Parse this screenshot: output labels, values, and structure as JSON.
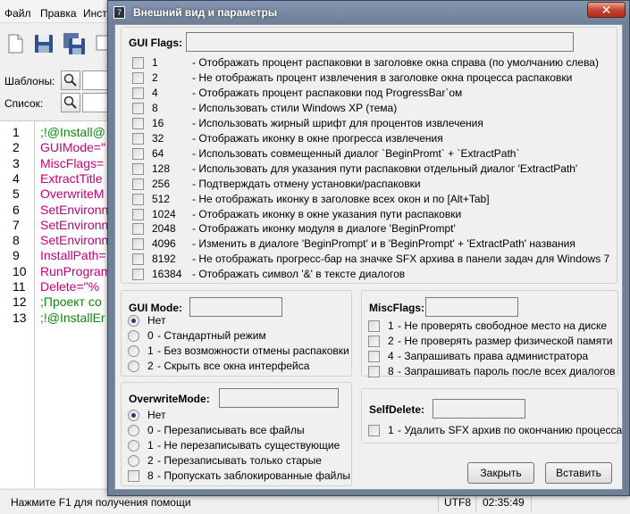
{
  "app": {
    "menu": [
      "Файл",
      "Правка",
      "Инстр"
    ],
    "templates_label": "Шаблоны:",
    "list_label": "Список:",
    "editor_lines": [
      {
        "num": "1",
        "code": ";!@Install@",
        "color": "#0a8a0a"
      },
      {
        "num": "2",
        "code": "GUIMode=\"",
        "color": "#c0007a"
      },
      {
        "num": "3",
        "code": "MiscFlags=",
        "color": "#c0007a"
      },
      {
        "num": "4",
        "code": "ExtractTitle",
        "color": "#c0007a"
      },
      {
        "num": "5",
        "code": "OverwriteM",
        "color": "#c0007a"
      },
      {
        "num": "6",
        "code": "SetEnvironn",
        "color": "#c0007a"
      },
      {
        "num": "7",
        "code": "SetEnvironn",
        "color": "#c0007a"
      },
      {
        "num": "8",
        "code": "SetEnvironn",
        "color": "#c0007a"
      },
      {
        "num": "9",
        "code": "InstallPath=",
        "color": "#c0007a"
      },
      {
        "num": "10",
        "code": "RunProgram",
        "color": "#c0007a"
      },
      {
        "num": "11",
        "code": "Delete=\"%",
        "color": "#c0007a"
      },
      {
        "num": "12",
        "code": ";Проект со",
        "color": "#0a8a0a"
      },
      {
        "num": "13",
        "code": ";!@InstallEr",
        "color": "#0a8a0a"
      }
    ],
    "status": {
      "help": "Нажмите F1 для получения помощи",
      "encoding": "UTF8",
      "time": "02:35:49"
    }
  },
  "dialog": {
    "title": "Внешний вид и параметры",
    "close_glyph": "✕",
    "gui_flags": {
      "label": "GUI Flags:",
      "items": [
        {
          "value": "1",
          "desc": "- Отображать процент распаковки в заголовке окна справа (по умолчанию слева)"
        },
        {
          "value": "2",
          "desc": "- Не отображать процент извлечения в заголовке окна процесса распаковки"
        },
        {
          "value": "4",
          "desc": "- Отображать процент распаковки под ProgressBar`ом"
        },
        {
          "value": "8",
          "desc": "- Использовать стили Windows XP (тема)"
        },
        {
          "value": "16",
          "desc": "- Использовать жирный шрифт для процентов извлечения"
        },
        {
          "value": "32",
          "desc": "- Отображать иконку в окне прогресса извлечения"
        },
        {
          "value": "64",
          "desc": "- Использовать совмещенный диалог `BeginPromt` + `ExtractPath`"
        },
        {
          "value": "128",
          "desc": "- Использовать для указания пути распаковки отдельный диалог 'ExtractPath'"
        },
        {
          "value": "256",
          "desc": "- Подтверждать отмену установки/распаковки"
        },
        {
          "value": "512",
          "desc": "- Не отображать иконку в заголовке всех окон и по [Alt+Tab]"
        },
        {
          "value": "1024",
          "desc": "- Отображать иконку в окне указания пути распаковки"
        },
        {
          "value": "2048",
          "desc": "- Отображать иконку модуля в диалоге 'BeginPrompt'"
        },
        {
          "value": "4096",
          "desc": "- Изменить в диалоге 'BeginPrompt' и в 'BeginPrompt' + 'ExtractPath' названия"
        },
        {
          "value": "8192",
          "desc": "- Не отображать прогресс-бар на значке SFX архива в панели задач для Windows 7"
        },
        {
          "value": "16384",
          "desc": "- Отображать символ '&' в тексте диалогов"
        }
      ]
    },
    "gui_mode": {
      "label": "GUI Mode:",
      "options": [
        {
          "value": "Нет",
          "desc": ""
        },
        {
          "value": "0",
          "desc": "- Стандартный режим"
        },
        {
          "value": "1",
          "desc": "- Без возможности отмены распаковки"
        },
        {
          "value": "2",
          "desc": "- Скрыть все окна интерфейса"
        }
      ]
    },
    "misc_flags": {
      "label": "MiscFlags:",
      "items": [
        {
          "value": "1",
          "desc": "- Не проверять свободное место на диске"
        },
        {
          "value": "2",
          "desc": "- Не проверять размер физической памяти"
        },
        {
          "value": "4",
          "desc": "- Запрашивать права администратора"
        },
        {
          "value": "8",
          "desc": "- Запрашивать пароль после всех диалогов"
        }
      ]
    },
    "overwrite_mode": {
      "label": "OverwriteMode:",
      "options": [
        {
          "value": "Нет",
          "desc": ""
        },
        {
          "value": "0",
          "desc": "- Перезаписывать все файлы"
        },
        {
          "value": "1",
          "desc": "- Не перезаписывать существующие"
        },
        {
          "value": "2",
          "desc": "- Перезаписывать только старые"
        }
      ],
      "checkbox": {
        "value": "8",
        "desc": "- Пропускать заблокированные файлы"
      }
    },
    "self_delete": {
      "label": "SelfDelete:",
      "item": {
        "value": "1",
        "desc": "- Удалить SFX архив по окончанию процесса"
      }
    },
    "buttons": {
      "close": "Закрыть",
      "insert": "Вставить"
    }
  }
}
